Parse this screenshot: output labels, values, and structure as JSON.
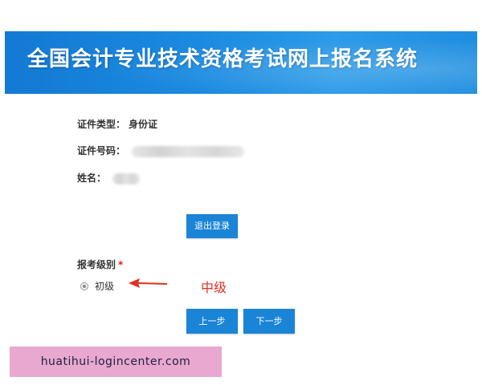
{
  "header": {
    "title": "全国会计专业技术资格考试网上报名系统"
  },
  "profile": {
    "id_type_label": "证件类型：",
    "id_type_value": "身份证",
    "id_number_label": "证件号码：",
    "name_label": "姓名："
  },
  "actions": {
    "logout_label": "退出登录",
    "prev_label": "上一步",
    "next_label": "下一步"
  },
  "exam_level": {
    "heading": "报考级别",
    "required_mark": "*",
    "options": [
      {
        "label": "初级",
        "selected": true
      }
    ]
  },
  "annotation": {
    "text": "中级",
    "color": "#e03020"
  },
  "watermark": {
    "text": "huatihui-logincenter.com"
  },
  "colors": {
    "banner": "#1a8ae0",
    "button": "#1a84d6",
    "required": "#e02020"
  }
}
